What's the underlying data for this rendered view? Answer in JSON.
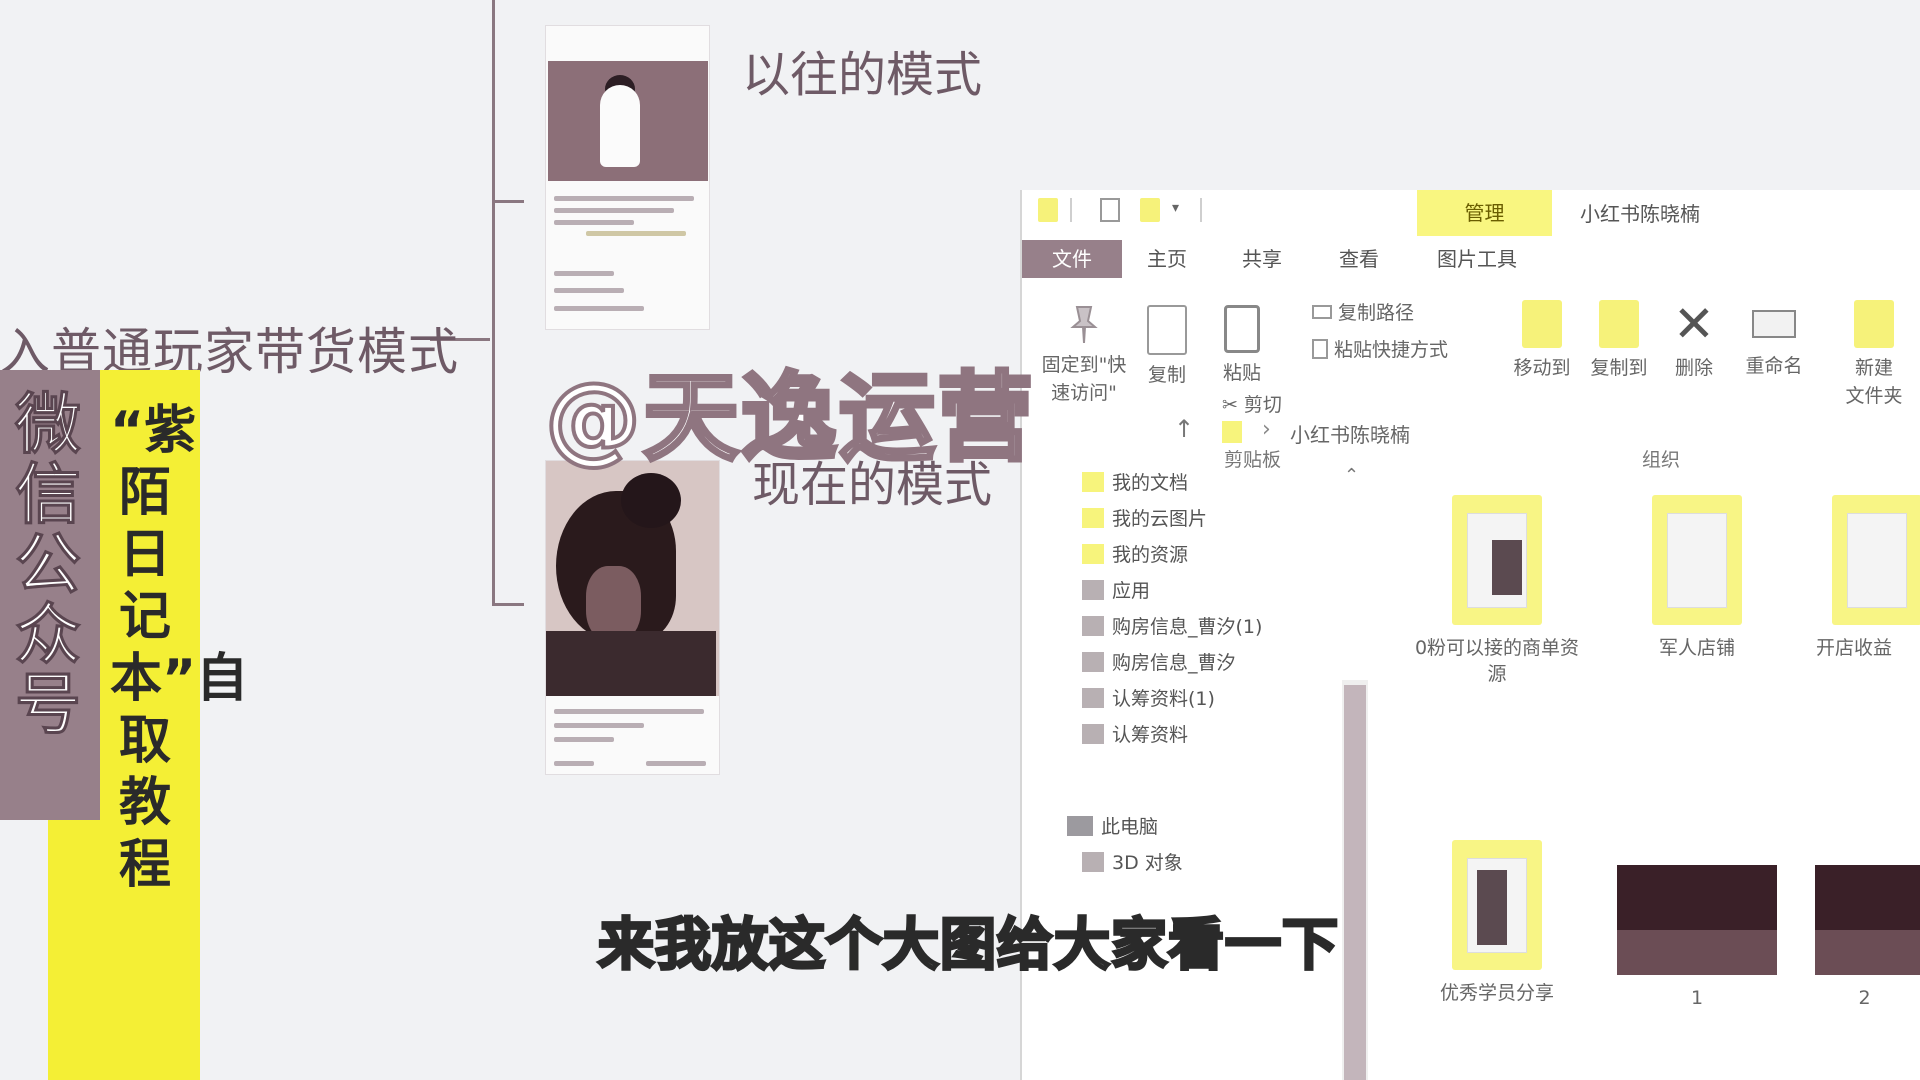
{
  "mindmap": {
    "root": "入普通玩家带货模式",
    "branch_old": "以往的模式",
    "branch_new": "现在的模式"
  },
  "explorer": {
    "manage_tab": "管理",
    "window_title": "小红书陈晓楠",
    "tabs": [
      "文件",
      "主页",
      "共享",
      "查看",
      "图片工具"
    ],
    "ribbon": {
      "pin": "固定到\"快速访问\"",
      "copy": "复制",
      "paste": "粘贴",
      "copy_path": "复制路径",
      "paste_shortcut": "粘贴快捷方式",
      "cut": "剪切",
      "clipboard_group": "剪贴板",
      "move_to": "移动到",
      "copy_to": "复制到",
      "delete": "删除",
      "rename": "重命名",
      "organize_group": "组织",
      "new_folder": "新建\n文件夹"
    },
    "address": {
      "up_icon": "↑",
      "separator": "›",
      "path": "小红书陈晓楠"
    },
    "nav": [
      "我的文档",
      "我的云图片",
      "我的资源",
      "应用",
      "购房信息_曹汐(1)",
      "购房信息_曹汐",
      "认筹资料(1)",
      "认筹资料",
      "此电脑",
      "3D 对象"
    ],
    "items": [
      "0粉可以接的商单资源",
      "军人店铺",
      "开店收益",
      "优秀学员分享",
      "1",
      "2"
    ]
  },
  "banner": {
    "wechat": "微信公众号",
    "promo": "“紫陌日记本”自取教程"
  },
  "watermark": "@天逸运营",
  "subtitle": "来我放这个大图给大家看一下",
  "colors": {
    "accent_mauve": "#97808a",
    "accent_yellow": "#f4ef35",
    "folder_yellow": "#f7f47c",
    "background": "#f1f2f4"
  }
}
